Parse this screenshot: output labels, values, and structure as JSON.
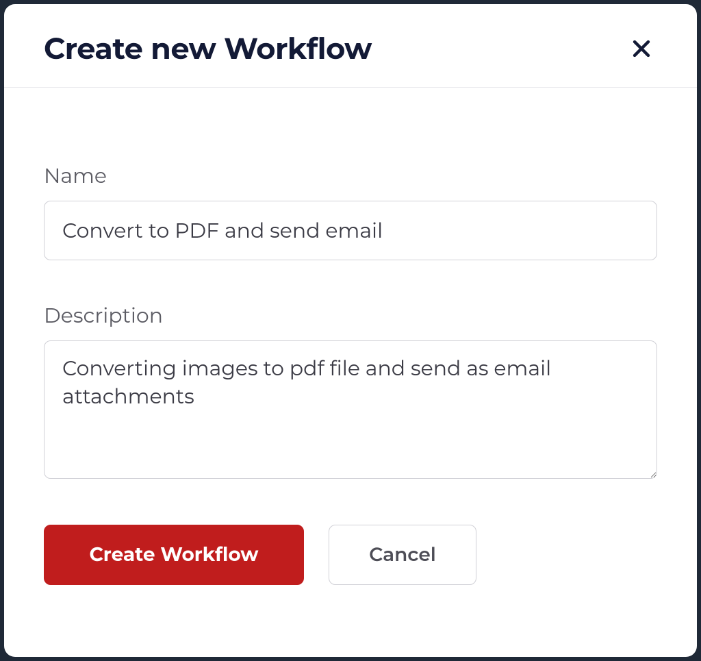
{
  "modal": {
    "title": "Create new Workflow",
    "fields": {
      "name": {
        "label": "Name",
        "value": "Convert to PDF and send email"
      },
      "description": {
        "label": "Description",
        "value": "Converting images to pdf file and send as email attachments"
      }
    },
    "buttons": {
      "primary": "Create Workflow",
      "secondary": "Cancel"
    }
  }
}
